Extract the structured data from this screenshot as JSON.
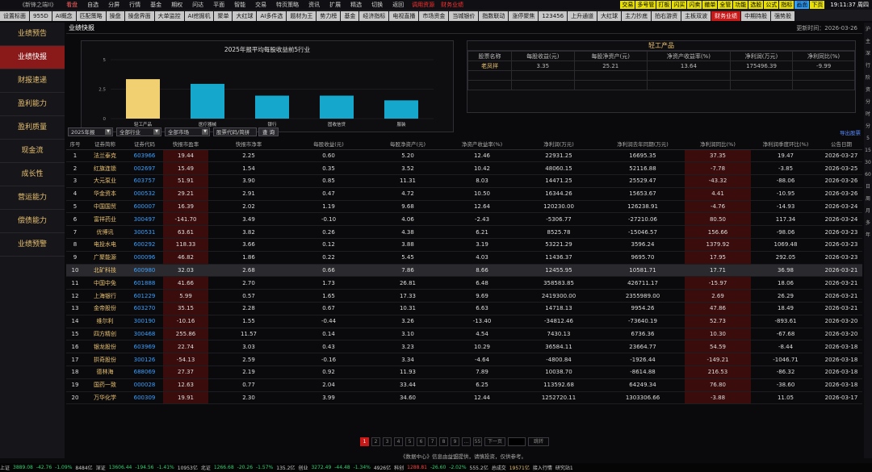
{
  "app": {
    "title": "《新锋之端II》",
    "menu": [
      "看盘",
      "自选",
      "分屏",
      "行情",
      "基金",
      "期权",
      "问达",
      "平面",
      "智能",
      "交易",
      "特页策略",
      "资讯",
      "扩展",
      "精选",
      "切换",
      "返回"
    ],
    "active_menu": "看盘",
    "hot_news": "调用资源",
    "alert_text": "财务业绩",
    "right_buttons": [
      {
        "label": "交易",
        "color": "#e8e000"
      },
      {
        "label": "多号管",
        "color": "#e8e000"
      },
      {
        "label": "打板",
        "color": "#e8e000"
      },
      {
        "label": "闪买",
        "color": "#e8e000"
      },
      {
        "label": "闪卖",
        "color": "#e8e000"
      },
      {
        "label": "撤单",
        "color": "#e8e000"
      },
      {
        "label": "全管",
        "color": "#e8e000"
      },
      {
        "label": "功能",
        "color": "#e8e000"
      },
      {
        "label": "选股",
        "color": "#e8e000"
      },
      {
        "label": "公式",
        "color": "#e8e000"
      },
      {
        "label": "指标",
        "color": "#e8e000"
      },
      {
        "label": "画面",
        "color": "#30a0ff"
      },
      {
        "label": "下页",
        "color": "#e8e000"
      }
    ],
    "clock": "19:11:37 周四"
  },
  "tabs": [
    "设置标面",
    "955D",
    "AI概念",
    "匹配策略",
    "操盘",
    "操盘界面",
    "大单监控",
    "AI挖掘机",
    "聚单",
    "大红球",
    "AI多件选",
    "题材为王",
    "势力榜",
    "基金",
    "经济指标",
    "电视直播",
    "市场资金",
    "当城银价",
    "指数联动",
    "涨停聚焦",
    "123456",
    "上升通道",
    "大红球",
    "主力抄底",
    "拍右游资",
    "主板双波",
    "财务业绩",
    "中期持股",
    "强势股"
  ],
  "active_tab": "财务业绩",
  "sidebar": [
    "业绩预告",
    "业绩快报",
    "财报速递",
    "盈利能力",
    "盈利质量",
    "现金流",
    "成长性",
    "营运能力",
    "偿债能力",
    "业绩预警"
  ],
  "active_side": "业绩快报",
  "header": {
    "title": "业绩快报",
    "updated": "更新时间：2026-03-26"
  },
  "chart_data": {
    "type": "bar",
    "title": "2025年报平均每股收益前5行业",
    "categories": [
      "轻工产品",
      "医疗器械",
      "银行",
      "固收信贷",
      "服装"
    ],
    "values": [
      3.35,
      2.95,
      1.95,
      1.95,
      1.55
    ],
    "ylim": [
      0,
      5
    ],
    "yticks": [
      0,
      2.5,
      5
    ],
    "colors": [
      "#f0d070",
      "#16a8cc",
      "#16a8cc",
      "#16a8cc",
      "#16a8cc"
    ],
    "grid": true
  },
  "product": {
    "title": "轻工产品",
    "headers": [
      "股票名称",
      "每股收益(元)",
      "每股净资产(元)",
      "净资产收益率(%)",
      "净利润(万元)",
      "净利同比(%)"
    ],
    "row": [
      "老凤祥",
      "3.35",
      "25.21",
      "13.64",
      "175496.39",
      "-9.99"
    ]
  },
  "controls": {
    "year": "2025年报",
    "industry": "全部行业",
    "market": "全部市场",
    "search_placeholder": "股票代码/简拼",
    "query": "查 询",
    "export": "导出股票"
  },
  "table": {
    "headers": [
      "序号",
      "证券简称",
      "证券代码",
      "快报市盈率",
      "快报市净率",
      "每股收益(元)",
      "每股净资产(元)",
      "净资产收益率(%)",
      "净利润(万元)",
      "净利润去年同期(万元)",
      "净利润同比(%)",
      "净利润季度环比(%)",
      "公告日期"
    ],
    "rows": [
      [
        "1",
        "法兰泰克",
        "603966",
        "19.44",
        "2.25",
        "0.60",
        "5.20",
        "12.46",
        "22931.25",
        "16695.35",
        "37.35",
        "19.47",
        "2026-03-27"
      ],
      [
        "2",
        "红旗连锁",
        "002697",
        "15.49",
        "1.54",
        "0.35",
        "3.52",
        "10.42",
        "48060.15",
        "52116.88",
        "-7.78",
        "-3.85",
        "2026-03-25"
      ],
      [
        "3",
        "大元泵业",
        "603757",
        "51.91",
        "3.90",
        "0.85",
        "11.31",
        "8.03",
        "14471.25",
        "25529.47",
        "-43.32",
        "-88.06",
        "2026-03-26"
      ],
      [
        "4",
        "华金资本",
        "000532",
        "29.21",
        "2.91",
        "0.47",
        "4.72",
        "10.50",
        "16344.26",
        "15653.67",
        "4.41",
        "-10.95",
        "2026-03-26"
      ],
      [
        "5",
        "中国国贸",
        "600007",
        "16.39",
        "2.02",
        "1.19",
        "9.68",
        "12.64",
        "120230.00",
        "126238.91",
        "-4.76",
        "-14.93",
        "2026-03-24"
      ],
      [
        "6",
        "富祥药业",
        "300497",
        "-141.70",
        "3.49",
        "-0.10",
        "4.06",
        "-2.43",
        "-5306.77",
        "-27210.06",
        "80.50",
        "117.34",
        "2026-03-24"
      ],
      [
        "7",
        "优博讯",
        "300531",
        "63.61",
        "3.82",
        "0.26",
        "4.38",
        "6.21",
        "8525.78",
        "-15046.57",
        "156.66",
        "-98.06",
        "2026-03-23"
      ],
      [
        "8",
        "电投水电",
        "600292",
        "118.33",
        "3.66",
        "0.12",
        "3.88",
        "3.19",
        "53221.29",
        "3596.24",
        "1379.92",
        "1069.48",
        "2026-03-23"
      ],
      [
        "9",
        "广聚能源",
        "000096",
        "46.82",
        "1.86",
        "0.22",
        "5.45",
        "4.03",
        "11436.37",
        "9695.70",
        "17.95",
        "292.05",
        "2026-03-23"
      ],
      [
        "10",
        "北矿科技",
        "600980",
        "32.03",
        "2.68",
        "0.66",
        "7.86",
        "8.66",
        "12455.95",
        "10581.71",
        "17.71",
        "36.98",
        "2026-03-21"
      ],
      [
        "11",
        "中国中免",
        "601888",
        "41.66",
        "2.70",
        "1.73",
        "26.81",
        "6.48",
        "358583.85",
        "426711.17",
        "-15.97",
        "18.06",
        "2026-03-21"
      ],
      [
        "12",
        "上海银行",
        "601229",
        "5.99",
        "0.57",
        "1.65",
        "17.33",
        "9.69",
        "2419300.00",
        "2355989.00",
        "2.69",
        "26.29",
        "2026-03-21"
      ],
      [
        "13",
        "金帝股份",
        "603270",
        "35.15",
        "2.28",
        "0.67",
        "10.31",
        "6.63",
        "14718.13",
        "9954.26",
        "47.86",
        "18.49",
        "2026-03-21"
      ],
      [
        "14",
        "维尔利",
        "300190",
        "-10.16",
        "1.55",
        "-0.44",
        "3.26",
        "-13.40",
        "-34812.46",
        "-73640.19",
        "52.73",
        "-893.61",
        "2026-03-20"
      ],
      [
        "15",
        "四方精创",
        "300468",
        "255.86",
        "11.57",
        "0.14",
        "3.10",
        "4.54",
        "7430.13",
        "6736.36",
        "10.30",
        "-67.68",
        "2026-03-20"
      ],
      [
        "16",
        "银龙股份",
        "603969",
        "22.74",
        "3.03",
        "0.43",
        "3.23",
        "10.29",
        "36584.11",
        "23664.77",
        "54.59",
        "-8.44",
        "2026-03-18"
      ],
      [
        "17",
        "拱奇股份",
        "300126",
        "-54.13",
        "2.59",
        "-0.16",
        "3.34",
        "-4.64",
        "-4800.84",
        "-1926.44",
        "-149.21",
        "-1046.71",
        "2026-03-18"
      ],
      [
        "18",
        "德林海",
        "688069",
        "27.37",
        "2.19",
        "0.92",
        "11.93",
        "7.89",
        "10038.70",
        "-8614.88",
        "216.53",
        "-86.32",
        "2026-03-18"
      ],
      [
        "19",
        "国药一致",
        "000028",
        "12.63",
        "0.77",
        "2.04",
        "33.44",
        "6.25",
        "113592.68",
        "64249.34",
        "76.80",
        "-38.60",
        "2026-03-18"
      ],
      [
        "20",
        "万华化学",
        "600309",
        "19.91",
        "2.30",
        "3.99",
        "34.60",
        "12.44",
        "1252720.11",
        "1303306.66",
        "-3.88",
        "11.05",
        "2026-03-17"
      ]
    ],
    "selected_row": 10
  },
  "pager": {
    "pages": [
      "1",
      "2",
      "3",
      "4",
      "5",
      "6",
      "7",
      "8",
      "9",
      "...",
      "55"
    ],
    "active": "1",
    "next": "下一页",
    "go": "跳转"
  },
  "footnote": "《数据中心》信息由益盟提供，请慎投资，仅供参考。",
  "rightbar": [
    "沪",
    "主",
    "深",
    "行",
    "阶",
    "资",
    "分",
    "时",
    "分",
    "5",
    "15",
    "30",
    "60",
    "日",
    "周",
    "月",
    "多",
    "年"
  ],
  "status": [
    {
      "t": "上证",
      "c": ""
    },
    {
      "t": "3889.08",
      "c": "g"
    },
    {
      "t": "-42.76",
      "c": "g"
    },
    {
      "t": "-1.09%",
      "c": "g"
    },
    {
      "t": "8484亿",
      "c": ""
    },
    {
      "t": "深证",
      "c": ""
    },
    {
      "t": "13606.44",
      "c": "g"
    },
    {
      "t": "-194.56",
      "c": "g"
    },
    {
      "t": "-1.41%",
      "c": "g"
    },
    {
      "t": "10953亿",
      "c": ""
    },
    {
      "t": "北证",
      "c": ""
    },
    {
      "t": "1266.68",
      "c": "g"
    },
    {
      "t": "-20.26",
      "c": "g"
    },
    {
      "t": "-1.57%",
      "c": "g"
    },
    {
      "t": "135.2亿",
      "c": ""
    },
    {
      "t": "创业",
      "c": ""
    },
    {
      "t": "3272.49",
      "c": "g"
    },
    {
      "t": "-44.48",
      "c": "g"
    },
    {
      "t": "-1.34%",
      "c": "g"
    },
    {
      "t": "4926亿",
      "c": ""
    },
    {
      "t": "科创",
      "c": ""
    },
    {
      "t": "1288.81",
      "c": "r"
    },
    {
      "t": "-26.60",
      "c": "g"
    },
    {
      "t": "-2.02%",
      "c": "g"
    },
    {
      "t": "555.2亿",
      "c": ""
    },
    {
      "t": "总成交",
      "c": ""
    },
    {
      "t": "19571亿",
      "c": "y"
    },
    {
      "t": "接入行情",
      "c": ""
    },
    {
      "t": "研究站1",
      "c": ""
    }
  ]
}
